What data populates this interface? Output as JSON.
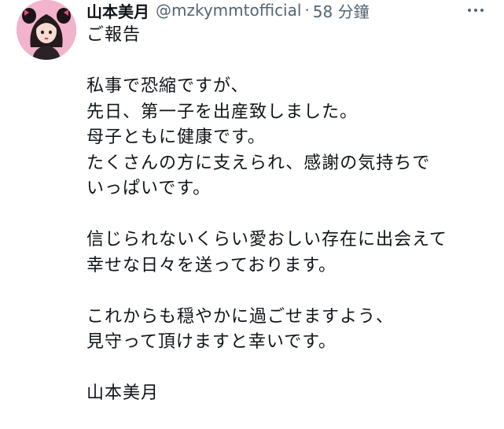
{
  "tweet": {
    "author": {
      "display_name": "山本美月",
      "handle": "@mzkymmtofficial",
      "avatar_icon": "profile-photo"
    },
    "separator": "·",
    "time": "58 分鐘",
    "more_icon": "more-horizontal-icon",
    "lines": [
      "ご報告",
      "",
      "私事で恐縮ですが、",
      "先日、第一子を出産致しました。",
      "母子ともに健康です。",
      "たくさんの方に支えられ、感謝の気持ちで",
      "いっぱいです。",
      "",
      "信じられないくらい愛おしい存在に出会えて",
      "幸せな日々を送っております。",
      "",
      "これからも穏やかに過ごせますよう、",
      "見守って頂けますと幸いです。",
      "",
      "山本美月"
    ]
  },
  "colors": {
    "text_primary": "#0f1419",
    "text_secondary": "#536471",
    "background": "#ffffff"
  }
}
